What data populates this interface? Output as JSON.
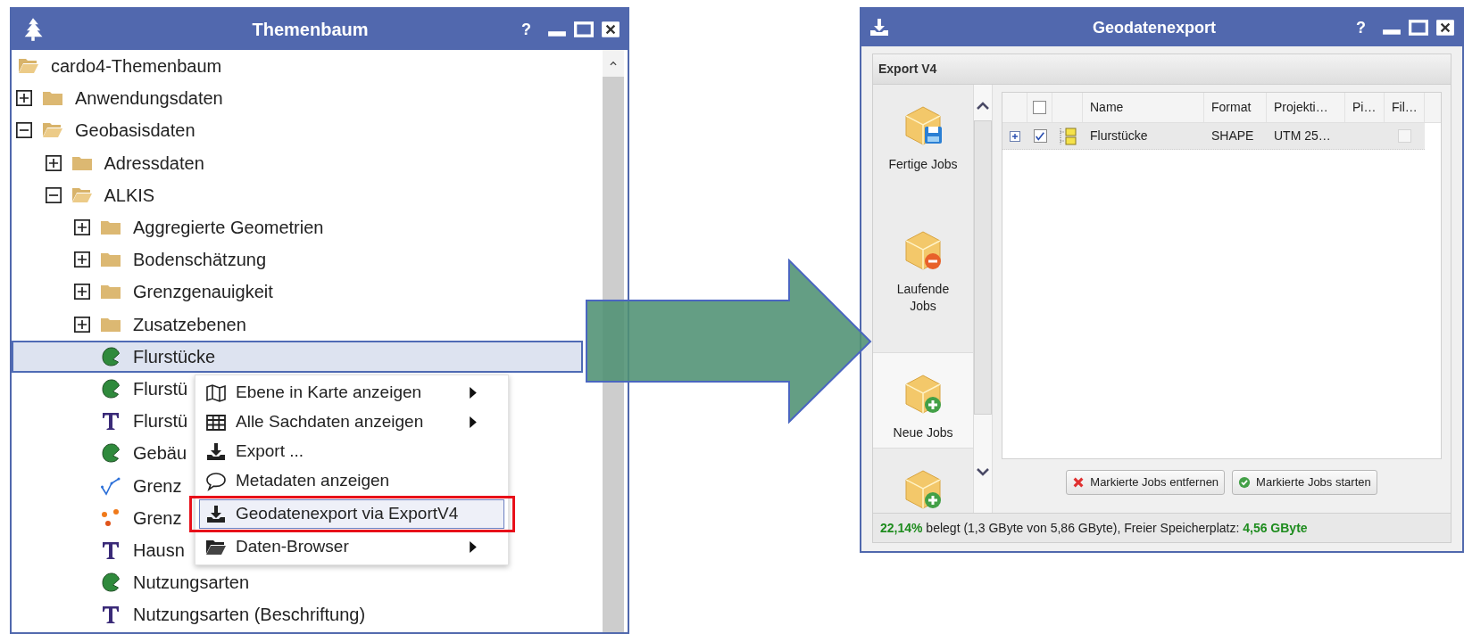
{
  "left_window": {
    "title": "Themenbaum",
    "help_label": "?"
  },
  "tree": [
    {
      "label": "cardo4-Themenbaum",
      "kind": "folder",
      "expanded": true,
      "selected": false,
      "children": [
        {
          "label": "Anwendungsdaten",
          "kind": "folder",
          "expanded": false,
          "selected": false
        },
        {
          "label": "Geobasisdaten",
          "kind": "folder",
          "expanded": true,
          "selected": false,
          "children": [
            {
              "label": "Adressdaten",
              "kind": "folder",
              "expanded": false,
              "selected": false
            },
            {
              "label": "ALKIS",
              "kind": "folder",
              "expanded": true,
              "selected": false,
              "children": [
                {
                  "label": "Aggregierte Geometrien",
                  "kind": "folder",
                  "expanded": false,
                  "selected": false
                },
                {
                  "label": "Bodenschätzung",
                  "kind": "folder",
                  "expanded": false,
                  "selected": false
                },
                {
                  "label": "Grenzgenauigkeit",
                  "kind": "folder",
                  "expanded": false,
                  "selected": false
                },
                {
                  "label": "Zusatzebenen",
                  "kind": "folder",
                  "expanded": false,
                  "selected": false
                },
                {
                  "label": "Flurstücke",
                  "kind": "area",
                  "selected": true
                },
                {
                  "label": "Flurstü",
                  "kind": "area",
                  "selected": false
                },
                {
                  "label": "Flurstü",
                  "kind": "text",
                  "selected": false
                },
                {
                  "label": "Gebäu",
                  "kind": "area",
                  "selected": false
                },
                {
                  "label": "Grenz",
                  "kind": "line",
                  "selected": false
                },
                {
                  "label": "Grenz",
                  "kind": "points",
                  "selected": false
                },
                {
                  "label": "Hausn",
                  "kind": "text",
                  "selected": false
                },
                {
                  "label": "Nutzungsarten",
                  "kind": "area",
                  "selected": false
                },
                {
                  "label": "Nutzungsarten (Beschriftung)",
                  "kind": "text",
                  "selected": false
                }
              ]
            }
          ]
        }
      ]
    }
  ],
  "context_menu": {
    "items": [
      {
        "label": "Ebene in Karte anzeigen",
        "kind": "map",
        "submenu": true,
        "selected": false
      },
      {
        "label": "Alle Sachdaten anzeigen",
        "kind": "table",
        "submenu": true,
        "selected": false
      },
      {
        "label": "Export ...",
        "kind": "download",
        "submenu": false,
        "selected": false
      },
      {
        "label": "Metadaten anzeigen",
        "kind": "comment",
        "submenu": false,
        "selected": false
      },
      {
        "label": "Geodatenexport via ExportV4",
        "kind": "download",
        "submenu": false,
        "selected": true
      },
      {
        "label": "Daten-Browser",
        "kind": "folder",
        "submenu": true,
        "selected": false
      }
    ]
  },
  "right_window": {
    "title": "Geodatenexport",
    "help_label": "?"
  },
  "panel": {
    "title": "Export V4"
  },
  "nav": [
    {
      "label": "Fertige Jobs",
      "kind": "done",
      "selected": false
    },
    {
      "label": "Laufende Jobs",
      "kind": "running",
      "selected": false
    },
    {
      "label": "Neue Jobs",
      "kind": "new",
      "selected": true
    },
    {
      "kind": "new",
      "selected": false
    }
  ],
  "grid": {
    "header_checked": false,
    "columns": [
      "Name",
      "Format",
      "Projekti…",
      "Pi…",
      "Fil…"
    ],
    "rows": [
      {
        "expanded": false,
        "checked": true,
        "selected": true,
        "cells": [
          "Flurstücke",
          "SHAPE",
          "UTM 25…",
          ""
        ],
        "file_checked": false
      }
    ]
  },
  "buttons": [
    {
      "label": "Markierte Jobs entfernen",
      "kind": "remove"
    },
    {
      "label": "Markierte Jobs starten",
      "kind": "start"
    }
  ],
  "status_bar": "**22,14%** belegt (1,3 GByte von 5,86 GByte), Freier Speicherplatz: **4,56 GByte**"
}
